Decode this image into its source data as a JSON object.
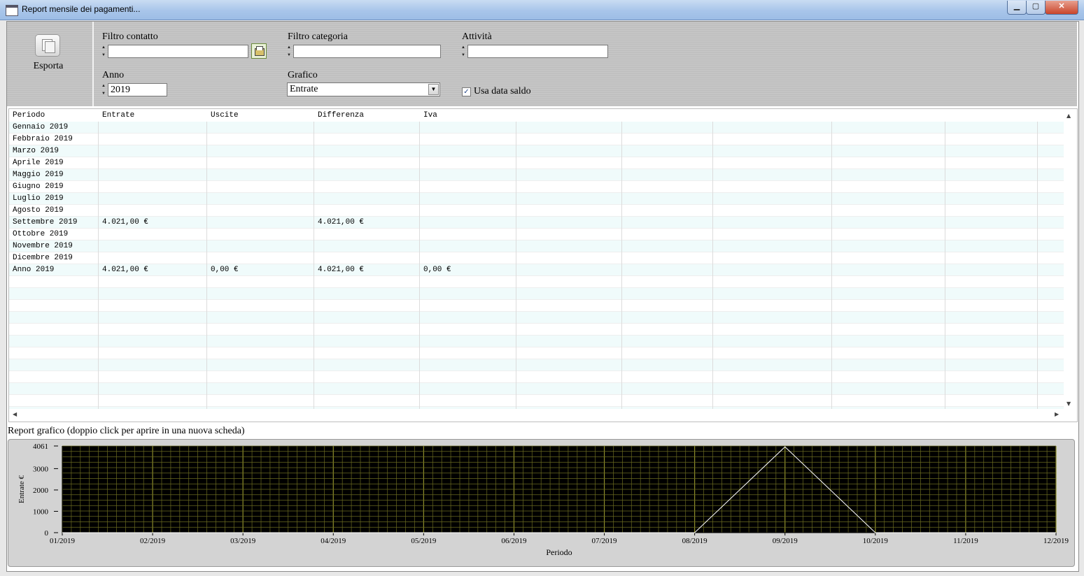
{
  "window": {
    "title": "Report mensile dei pagamenti...",
    "minimize": "▁",
    "maximize": "▢",
    "close": "✕"
  },
  "toolbar": {
    "export_label": "Esporta",
    "filters": {
      "contact_label": "Filtro contatto",
      "contact_value": "",
      "category_label": "Filtro categoria",
      "category_value": "",
      "activity_label": "Attività",
      "activity_value": "",
      "year_label": "Anno",
      "year_value": "2019",
      "chart_label": "Grafico",
      "chart_value": "Entrate",
      "use_balance_date_label": "Usa data saldo",
      "use_balance_date_checked": true,
      "check_mark": "✓",
      "dropdown_arrow": "▼"
    }
  },
  "table": {
    "columns": [
      "Periodo",
      "Entrate",
      "Uscite",
      "Differenza",
      "Iva"
    ],
    "rows": [
      [
        "Gennaio 2019",
        "",
        "",
        "",
        ""
      ],
      [
        "Febbraio 2019",
        "",
        "",
        "",
        ""
      ],
      [
        "Marzo 2019",
        "",
        "",
        "",
        ""
      ],
      [
        "Aprile 2019",
        "",
        "",
        "",
        ""
      ],
      [
        "Maggio 2019",
        "",
        "",
        "",
        ""
      ],
      [
        "Giugno 2019",
        "",
        "",
        "",
        ""
      ],
      [
        "Luglio 2019",
        "",
        "",
        "",
        ""
      ],
      [
        "Agosto 2019",
        "",
        "",
        "",
        ""
      ],
      [
        "Settembre 2019",
        "4.021,00 €",
        "",
        "4.021,00 €",
        ""
      ],
      [
        "Ottobre 2019",
        "",
        "",
        "",
        ""
      ],
      [
        "Novembre 2019",
        "",
        "",
        "",
        ""
      ],
      [
        "Dicembre 2019",
        "",
        "",
        "",
        ""
      ],
      [
        "Anno 2019",
        "4.021,00 €",
        "0,00 €",
        "4.021,00 €",
        "0,00 €"
      ]
    ],
    "colors": {
      "alt_row": "#f0fbfb",
      "grid_line": "#dcdcdc"
    }
  },
  "chart_section": {
    "title": "Report grafico (doppio click per aprire in una nuova scheda)"
  },
  "chart_data": {
    "type": "line",
    "x": [
      "01/2019",
      "02/2019",
      "03/2019",
      "04/2019",
      "05/2019",
      "06/2019",
      "07/2019",
      "08/2019",
      "09/2019",
      "10/2019",
      "11/2019",
      "12/2019"
    ],
    "values": [
      0,
      0,
      0,
      0,
      0,
      0,
      0,
      0,
      4021,
      0,
      0,
      0
    ],
    "xlabel": "Periodo",
    "ylabel": "Entrate €",
    "ylim": [
      0,
      4061
    ],
    "yticks": [
      "0",
      "1000",
      "2000",
      "3000",
      "4061"
    ],
    "yticks_values": [
      0,
      1000,
      2000,
      3000,
      4061
    ],
    "grid": true,
    "colors": {
      "background": "#000000",
      "grid": "#6a6a20",
      "grid_major": "#8c8c2a",
      "line": "#ffffff"
    }
  }
}
